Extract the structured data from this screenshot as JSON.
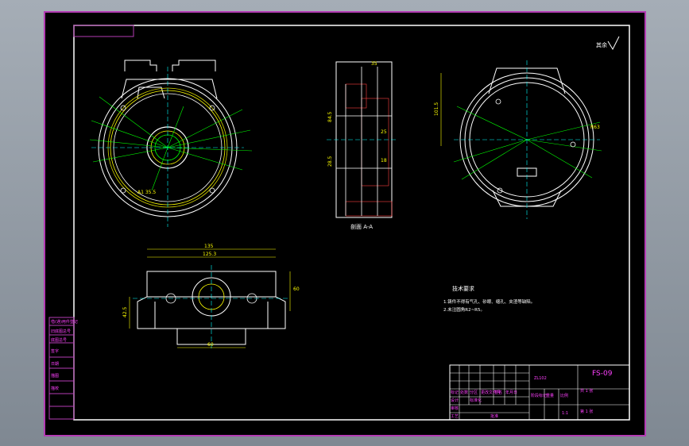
{
  "drawing": {
    "title_block": {
      "drawing_number": "FS-09",
      "material": "ZL102",
      "scale": "1:1",
      "sheets": "共 1 张",
      "sheet_no": "第 1 张",
      "company": "设计",
      "labels": [
        "标记",
        "处数",
        "分区",
        "更改文件号",
        "签名",
        "年月日",
        "设计",
        "标准化",
        "审核",
        "工艺",
        "批准",
        "阶段标记",
        "重量",
        "比例"
      ]
    },
    "side_stamps": [
      "借(通)用件登记",
      "旧底图总号",
      "底图总号",
      "签字",
      "日期",
      "描图",
      "描校"
    ],
    "surface_finish": "其余",
    "section_label": "剖面 A-A",
    "notes": {
      "title": "技术要求",
      "lines": [
        "1.铸件不得有气孔、砂眼、缩孔、夹渣等缺陷。",
        "2.未注圆角R2~R5。"
      ]
    },
    "dims": {
      "top_width": "135",
      "top_width2": "125.3",
      "height_right": "60",
      "height_left": "42.5",
      "bottom": "60",
      "side_top": "35",
      "side_a": "25",
      "side_b": "18",
      "right_r": "R63",
      "right_v": "101.5",
      "left_dim": "A1 35.5",
      "sec_a": "84.5",
      "sec_b": "28.5"
    }
  }
}
